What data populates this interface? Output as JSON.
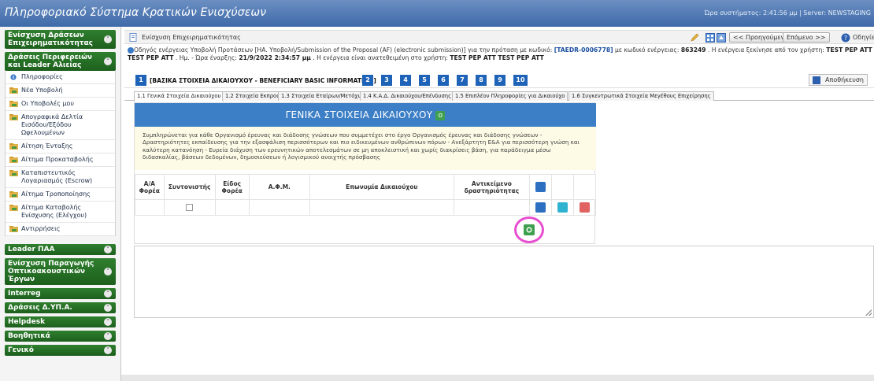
{
  "app": {
    "title": "Πληροφοριακό Σύστημα Κρατικών Ενισχύσεων",
    "status": "Ώρα συστήματος: 2:41:56 μμ | Server: NEWSTAGING"
  },
  "sidebar": {
    "sections": [
      {
        "label": "Ενίσχυση Δράσεων Επιχειρηματικότητας"
      },
      {
        "label": "Δράσεις Περιφερειών και Leader Αλιείας"
      }
    ],
    "items": [
      {
        "label": "Πληροφορίες"
      },
      {
        "label": "Νέα Υποβολή"
      },
      {
        "label": "Οι Υποβολές μου"
      },
      {
        "label": "Απογραφικά Δελτία Εισόδου/Εξόδου Ωφελουμένων"
      },
      {
        "label": "Αίτηση Ένταξης"
      },
      {
        "label": "Αίτημα Προκαταβολής"
      },
      {
        "label": "Καταπιστευτικός Λογαριασμός (Escrow)"
      },
      {
        "label": "Αίτημα Τροποποίησης"
      },
      {
        "label": "Αίτημα Καταβολής Ενίσχυσης (Ελέγχου)"
      },
      {
        "label": "Αντιρρήσεις"
      }
    ],
    "more_sections": [
      {
        "label": "Leader ΠΑΑ"
      },
      {
        "label": "Ενίσχυση Παραγωγής Οπτικοακουστικών Έργων"
      },
      {
        "label": "Interreg"
      },
      {
        "label": "Δράσεις Δ.ΥΠ.Α."
      },
      {
        "label": "Helpdesk"
      },
      {
        "label": "Βοηθητικά"
      },
      {
        "label": "Γενικό"
      }
    ]
  },
  "breadcrumb": {
    "label": "Ενίσχυση Επιχειρηματικότητας",
    "prev": "<< Προηγούμενο",
    "next": "Επόμενο >>",
    "help": "Οδηγίες"
  },
  "info": {
    "line1a": "Οδηγός ενέργειας Υποβολή Προτάσεων [ΗΑ. Υποβολή/Submission of the Proposal (AF) (electronic submission)] για την πρόταση με κωδικό: ",
    "code": "[TAEDR-0006778]",
    "line1b": " με κωδικό ενέργειας: ",
    "action_code": "863249",
    "line1c": " . Η ενέργεια ξεκίνησε από τον χρήστη: ",
    "user1": "TEST PEP ATT TEST PEP ATT",
    "line2a": " . Ημ. - Ώρα έναρξης: ",
    "start": "21/9/2022 2:34:57 μμ",
    "line2b": " . Η ενέργεια είναι ανατεθειμένη στο χρήστη: ",
    "user2": "TEST PEP ATT TEST PEP ATT"
  },
  "steps": {
    "numbers": [
      "1",
      "2",
      "3",
      "4",
      "5",
      "6",
      "7",
      "8",
      "9",
      "10"
    ],
    "active_label": "[ΒΑΣΙΚΑ ΣΤΟΙΧΕΙΑ ΔΙΚΑΙΟΥΧΟΥ - BENEFICIARY BASIC INFORMATION]",
    "save": "Αποθήκευση"
  },
  "tabs": [
    "1.1 Γενικά Στοιχεία Δικαιούχου",
    "1.2 Στοιχεία Εκπροσώπων",
    "1.3 Στοιχεία Εταίρων/Μετόχων",
    "1.4 Κ.Α.Δ. Δικαιούχου/Επένδυσης",
    "1.5 Επιπλέον Πληροφορίες για Δικαιούχο",
    "1.6 Συγκεντρωτικά Στοιχεία Μεγέθους Επιχείρησης"
  ],
  "panel": {
    "title": "ΓΕΝΙΚΑ ΣΤΟΙΧΕΙΑ ΔΙΚΑΙΟΥΧΟΥ",
    "note": "Συμπληρώνεται για κάθε Οργανισμό έρευνας και διάδοσης γνώσεων που συμμετέχει στο έργο Οργανισμός έρευνας και διάδοσης γνώσεων - Δραστηριότητες εκπαίδευσης για την εξασφάλιση περισσότερων και πιο ειδικευμένων ανθρώπινων πόρων - Ανεξάρτητη Ε&Α για περισσότερη γνώση και καλύτερη κατανόηση - Ευρεία διάχυση των ερευνητικών αποτελεσμάτων σε μη αποκλειστική και χωρίς διακρίσεις βάση, για παράδειγμα μέσω διδασκαλίας, βάσεων δεδομένων, δημοσιεύσεων ή λογισμικού ανοιχτής πρόσβασης",
    "columns": [
      "Α/Α Φορέα",
      "Συντονιστής",
      "Είδος Φορέα",
      "Α.Φ.Μ.",
      "Επωνυμία Δικαιούχου",
      "Αντικείμενο δραστηριότητας"
    ]
  },
  "colors": {
    "header": "#3e6aa8",
    "sidebar_section": "#2f7f2f",
    "step_blue": "#1e63b8",
    "panel_header": "#3d7fc6",
    "add_green": "#3ea04e",
    "delete_red": "#e06262",
    "highlight": "#e74fd0"
  }
}
